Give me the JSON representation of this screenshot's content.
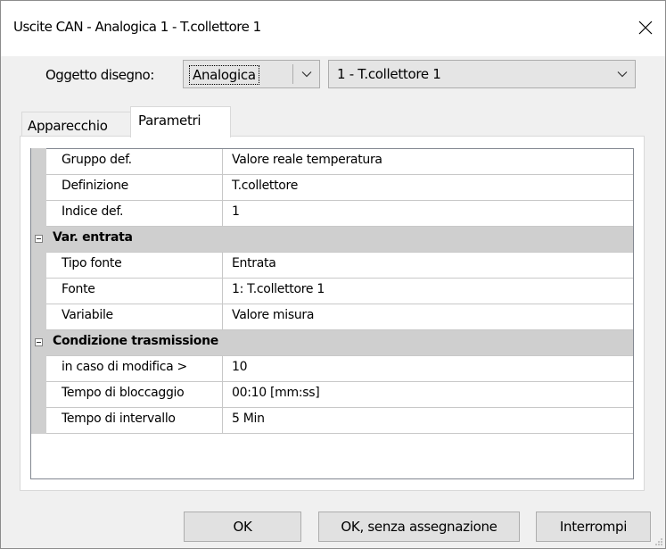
{
  "window": {
    "title": "Uscite CAN - Analogica 1 - T.collettore 1"
  },
  "object_selector": {
    "label": "Oggetto disegno:",
    "type_value": "Analogica",
    "item_value": "1 - T.collettore 1"
  },
  "tabs": [
    {
      "label": "Apparecchio",
      "active": false
    },
    {
      "label": "Parametri",
      "active": true
    }
  ],
  "properties": {
    "rows_top": [
      {
        "name": "Gruppo def.",
        "value": "Valore reale temperatura"
      },
      {
        "name": "Definizione",
        "value": "T.collettore"
      },
      {
        "name": "Indice def.",
        "value": "1"
      }
    ],
    "category_input": {
      "label": "Var. entrata",
      "rows": [
        {
          "name": "Tipo fonte",
          "value": "Entrata"
        },
        {
          "name": "Fonte",
          "value": "1: T.collettore 1"
        },
        {
          "name": "Variabile",
          "value": "Valore misura"
        }
      ]
    },
    "category_transmission": {
      "label": "Condizione trasmissione",
      "rows": [
        {
          "name": "in caso di modifica >",
          "value": "10"
        },
        {
          "name": "Tempo di bloccaggio",
          "value": "00:10 [mm:ss]"
        },
        {
          "name": "Tempo di intervallo",
          "value": "5 Min"
        }
      ]
    }
  },
  "buttons": {
    "ok": "OK",
    "ok_no_assign": "OK, senza assegnazione",
    "cancel": "Interrompi"
  },
  "icons": {
    "close": "close-icon",
    "dropdown": "chevron-down-icon",
    "collapse": "minus-box-icon"
  },
  "colors": {
    "dialog_bg": "#f0f0f0",
    "category_bg": "#cfcfcf",
    "grid_line": "#c8c8c8"
  }
}
